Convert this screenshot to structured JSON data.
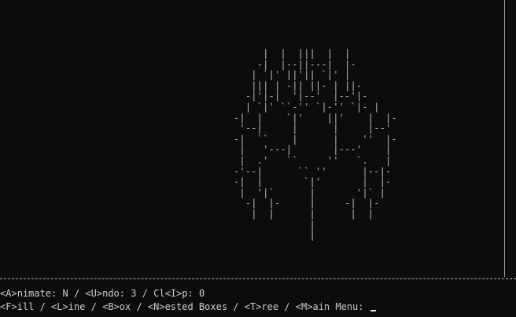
{
  "status": {
    "animate_key": "<A>",
    "animate_label": "nimate: ",
    "animate_value": "N",
    "sep1": " / ",
    "undo_key": "<U>",
    "undo_label": "ndo: ",
    "undo_value": "3",
    "sep2": " / ",
    "clip_prefix": "Cl",
    "clip_key": "<I>",
    "clip_label": "p: ",
    "clip_value": "0"
  },
  "menu": {
    "fill": "<F>ill",
    "line": "<L>ine",
    "box": "<B>ox",
    "nested": "<N>ested Boxes",
    "tree": "<T>ree",
    "main": "<M>ain Menu:",
    "separator": " / "
  },
  "canvas": {
    "art": "                                             |  |  |||  |  |\n                                            -|  |--||---|  |-\n                                           | `|' ||'|| `|' |\n                                           ||| | -|| ||- | ||-\n                                          -|'|-|  '|--'  |--'|-\n                                          | `|' ``-'' `|-'' `|- |\n                                        -|  |    `|'    ||'    |  |-\n                                         '--|     |      |     |--'\n                                        -|  ``    |      |    ''  |-\n                                         |   '---|       |---'    |\n                                         |  .'   ``     ''   `.   |\n                                        -'--|      `` ''      |--|-\n                                        -|  |       `|'       |  |-\n                                         |  '|`      |       '|` |\n                                          -|  |-     |     -|  |-\n                                           |  |      |      |  |\n                                                     |\n                                                     |"
  }
}
